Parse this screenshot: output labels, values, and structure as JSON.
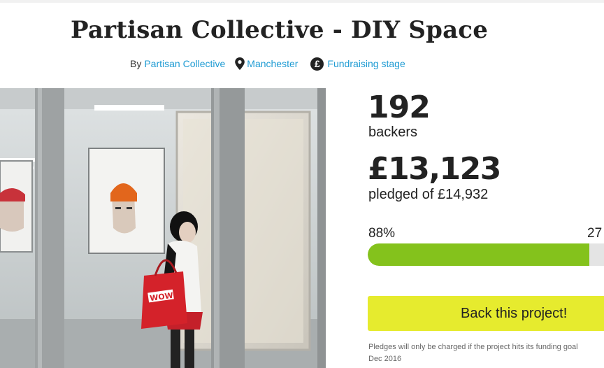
{
  "project": {
    "title": "Partisan Collective - DIY Space",
    "by_prefix": "By",
    "creator": "Partisan Collective",
    "location": "Manchester",
    "stage": "Fundraising stage"
  },
  "stats": {
    "backers_count": "192",
    "backers_label": "backers",
    "pledged_amount": "£13,123",
    "pledged_label": "pledged of £14,932",
    "percent_label": "88%",
    "percent_value": 88,
    "days_partial": "27"
  },
  "cta": {
    "back_label": "Back this project!"
  },
  "notice": {
    "line1": "Pledges will only be charged if the project hits its funding goal",
    "line2": "Dec 2016"
  },
  "colors": {
    "link": "#1e9bd3",
    "progress": "#84c21c",
    "button": "#e6eb2e"
  },
  "icons": {
    "location": "map-pin-icon",
    "stage": "pound-circle-icon"
  }
}
